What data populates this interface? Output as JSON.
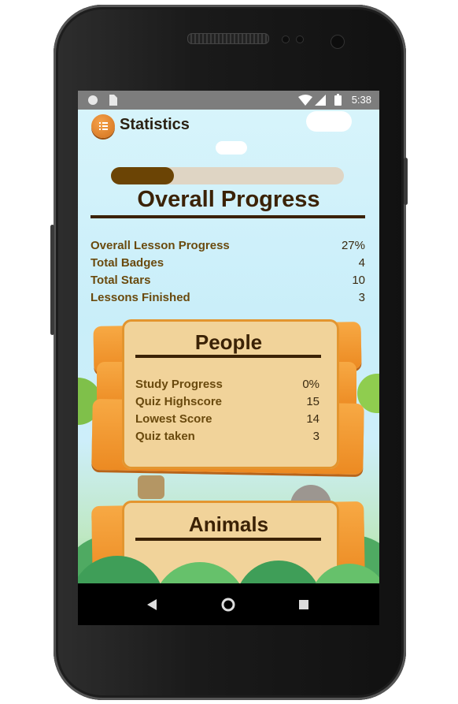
{
  "status": {
    "time": "5:38"
  },
  "header": {
    "title": "Statistics"
  },
  "overall": {
    "title": "Overall Progress",
    "progress": 0.27,
    "stats": [
      {
        "label": "Overall Lesson Progress",
        "value": "27%"
      },
      {
        "label": "Total Badges",
        "value": "4"
      },
      {
        "label": "Total Stars",
        "value": "10"
      },
      {
        "label": "Lessons Finished",
        "value": "3"
      }
    ]
  },
  "categories": [
    {
      "title": "People",
      "stats": [
        {
          "label": "Study Progress",
          "value": "0%"
        },
        {
          "label": "Quiz Highscore",
          "value": "15"
        },
        {
          "label": "Lowest Score",
          "value": "14"
        },
        {
          "label": "Quiz taken",
          "value": "3"
        }
      ]
    },
    {
      "title": "Animals"
    }
  ],
  "icons": {
    "header": "menu-icon",
    "nav_back": "back-triangle-icon",
    "nav_home": "home-circle-icon",
    "nav_recents": "recents-square-icon"
  },
  "colors": {
    "progress_fill": "#6b4405",
    "progress_track": "#dfd5c4",
    "wood": "#ec8a22",
    "board": "#f1d39a",
    "text_dark": "#3b2206"
  }
}
